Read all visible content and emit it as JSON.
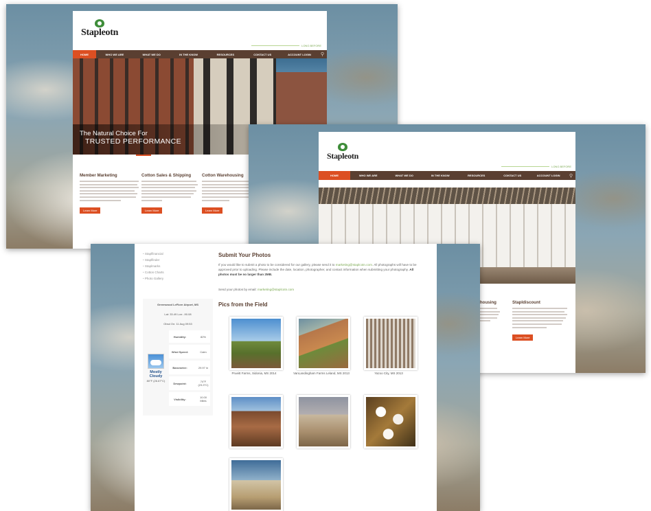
{
  "brand": {
    "name": "Stapleotn",
    "tagline": "LONG BEFORE"
  },
  "nav": {
    "items": [
      "HOME",
      "WHO WE ARE",
      "WHAT WE DO",
      "IN THE KNOW",
      "RESOURCES",
      "CONTACT US",
      "ACCOUNT LOGIN"
    ],
    "search_icon": "search-icon"
  },
  "hero": {
    "line1": "The Natural Choice For",
    "line2": "TRUSTED PERFORMANCE"
  },
  "features": [
    {
      "title": "Member Marketing",
      "button": "Learn More"
    },
    {
      "title": "Cotton Sales & Shipping",
      "button": "Learn More"
    },
    {
      "title": "Cotton Warehousing",
      "button": "Learn More"
    }
  ],
  "screen2_features": [
    {
      "title": "Warehousing",
      "button": "Learn More"
    },
    {
      "title": "Stapldiscount",
      "button": "Learn More"
    }
  ],
  "sidebar": {
    "links": [
      "Staplfinancial",
      "Staplfinder",
      "Staplmarks",
      "Cotton Charts",
      "Photo Gallery"
    ]
  },
  "weather": {
    "station": "Greenwood LeFlore Airport, MS",
    "latlon": "Lat: 33.49 Lon: -90.08",
    "observed": "Obsd On: 11 Aug 09:53",
    "condition": "Mostly Cloudy",
    "condition_temp": "80°F (26.67°C)",
    "rows": [
      {
        "label": "Humidity:",
        "value": "82%"
      },
      {
        "label": "Wind Speed:",
        "value": "Calm"
      },
      {
        "label": "Barometer:",
        "value": "29.97 in"
      },
      {
        "label": "Dewpoint:",
        "value": "74°F (23.3°C)"
      },
      {
        "label": "Visibility:",
        "value": "10.00 Miles"
      }
    ]
  },
  "submit": {
    "heading": "Submit Your Photos",
    "body_before": "If you would like to submit a photo to be considered for our gallery, please send it to ",
    "email": "marketing@staplcotn.com",
    "body_after": ". All photographs will have to be approved prior to uploading. Please include the date, location, photographer, and contact information when submitting your photography.",
    "bold_note": "All photos must be no larger than 2MB.",
    "send_line": "Send your photos by email:"
  },
  "gallery": {
    "heading": "Pics from the Field",
    "photos": [
      {
        "caption": "Prueitt Farms, Sidonia, MS 2014"
      },
      {
        "caption": "VanLandingham Farms Leland, MS 2013"
      },
      {
        "caption": "Yazoo City, MS 2013"
      },
      {
        "caption": ""
      },
      {
        "caption": ""
      },
      {
        "caption": ""
      },
      {
        "caption": ""
      }
    ]
  }
}
